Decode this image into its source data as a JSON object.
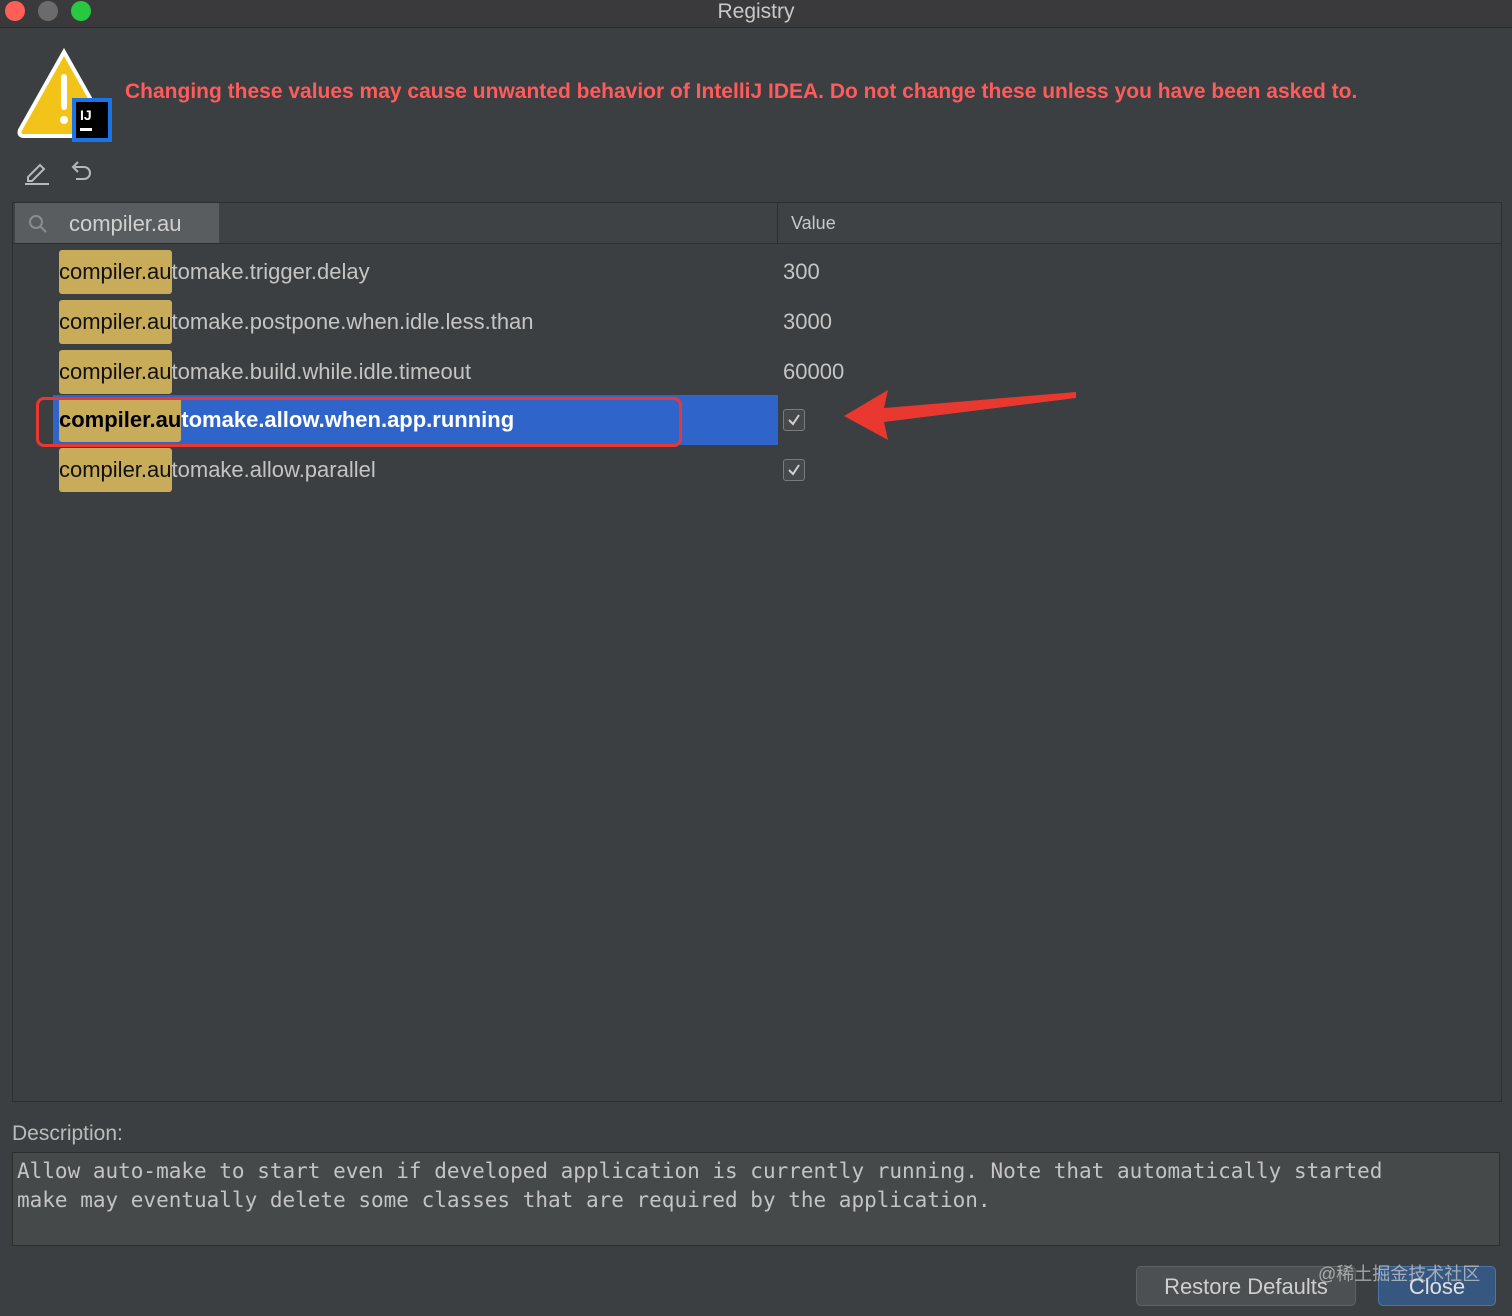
{
  "window": {
    "title": "Registry"
  },
  "warning": {
    "text": "Changing these values may cause unwanted behavior of IntelliJ IDEA. Do not change these unless you have been asked to.",
    "color": "#ff5b5b"
  },
  "toolbar": {
    "edit_icon": "edit-icon",
    "revert_icon": "revert-icon"
  },
  "table": {
    "search_value": "compiler.au",
    "value_header": "Value",
    "rows": [
      {
        "match": "compiler.au",
        "rest": "tomake.trigger.delay",
        "value": "300",
        "type": "text",
        "selected": false
      },
      {
        "match": "compiler.au",
        "rest": "tomake.postpone.when.idle.less.than",
        "value": "3000",
        "type": "text",
        "selected": false
      },
      {
        "match": "compiler.au",
        "rest": "tomake.build.while.idle.timeout",
        "value": "60000",
        "type": "text",
        "selected": false
      },
      {
        "match": "compiler.au",
        "rest": "tomake.allow.when.app.running",
        "value": true,
        "type": "checkbox",
        "selected": true
      },
      {
        "match": "compiler.au",
        "rest": "tomake.allow.parallel",
        "value": true,
        "type": "checkbox",
        "selected": false
      }
    ]
  },
  "description": {
    "label": "Description:",
    "text": "Allow auto-make to start even if developed application is currently running. Note that automatically started\nmake may eventually delete some classes that are required by the application."
  },
  "buttons": {
    "restore": "Restore Defaults",
    "close": "Close"
  },
  "watermark": "@稀土掘金技术社区",
  "colors": {
    "selection": "#2f65ca",
    "match_highlight": "#c9ac5a",
    "annotation": "#e8382f"
  }
}
